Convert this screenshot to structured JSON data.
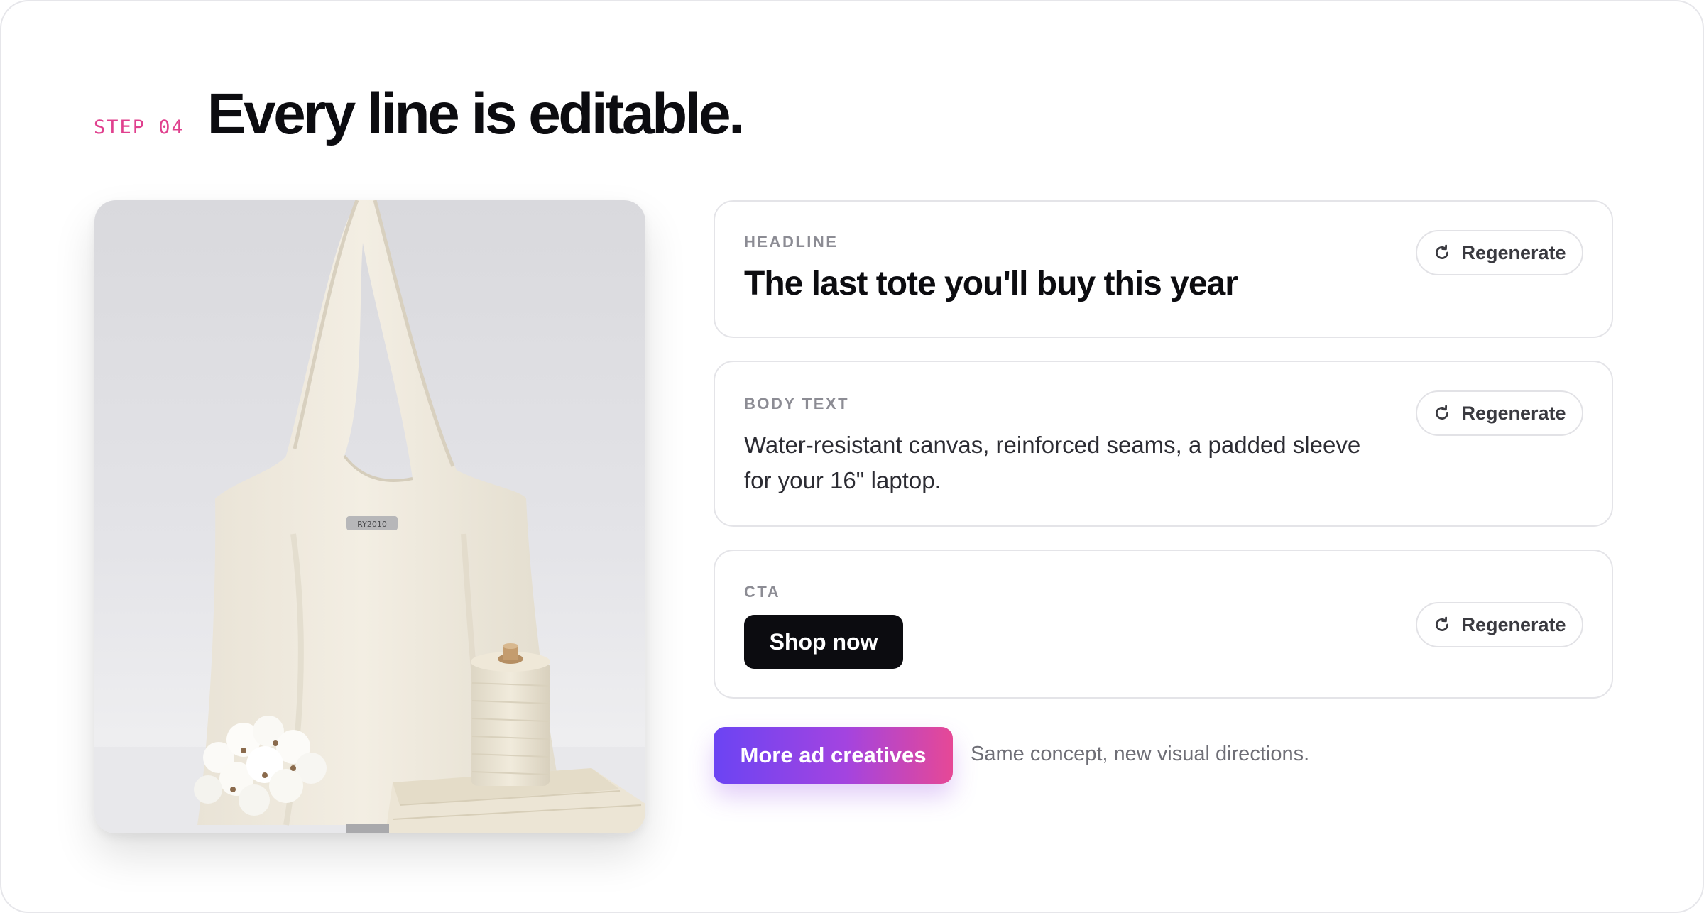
{
  "header": {
    "step_label": "STEP 04",
    "title": "Every line is editable."
  },
  "product_image": {
    "alt": "Cream canvas tote bag with cotton bolls and a spool of twine",
    "tag_text": "RY2010"
  },
  "fields": {
    "headline": {
      "label": "HEADLINE",
      "value": "The last tote you'll buy this year",
      "regenerate_label": "Regenerate"
    },
    "body": {
      "label": "BODY TEXT",
      "value": "Water-resistant canvas, reinforced seams, a padded sleeve for your 16\" laptop.",
      "regenerate_label": "Regenerate"
    },
    "cta": {
      "label": "CTA",
      "button_label": "Shop now",
      "regenerate_label": "Regenerate"
    }
  },
  "more": {
    "button_label": "More ad creatives",
    "caption": "Same concept, new visual directions."
  },
  "colors": {
    "step_accent": "#e0408e",
    "gradient_start": "#6b44f3",
    "gradient_end": "#e64896",
    "cta_background": "#0c0c10"
  },
  "icons": {
    "regenerate": "refresh-icon"
  }
}
